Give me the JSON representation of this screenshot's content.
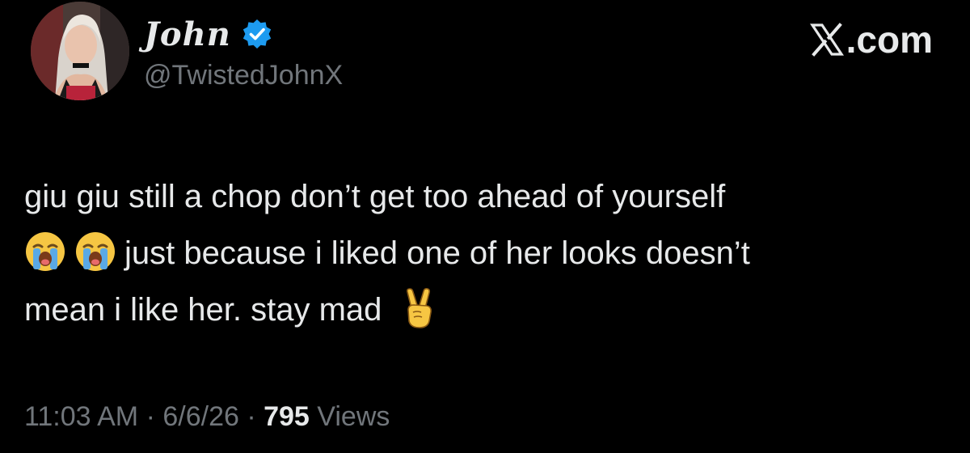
{
  "user": {
    "display_name": "John",
    "handle": "@TwistedJohnX",
    "verified_color": "#1d9bf0"
  },
  "brand": {
    "label": ".com",
    "logo_icon": "x-logo-icon"
  },
  "tweet": {
    "line1": "giu giu still a chop don’t get too ahead of yourself",
    "line2": "just because i liked one of her looks doesn’t",
    "line3": "mean i like her. stay mad",
    "emojis": [
      "loudly-crying-face-icon",
      "loudly-crying-face-icon",
      "victory-hand-icon"
    ]
  },
  "meta": {
    "time": "11:03 AM",
    "separator": " · ",
    "date": "6/6/26",
    "views_count": "795",
    "views_label": " Views"
  },
  "colors": {
    "background": "#000000",
    "text_primary": "#e7e9ea",
    "text_secondary": "#71767b"
  }
}
